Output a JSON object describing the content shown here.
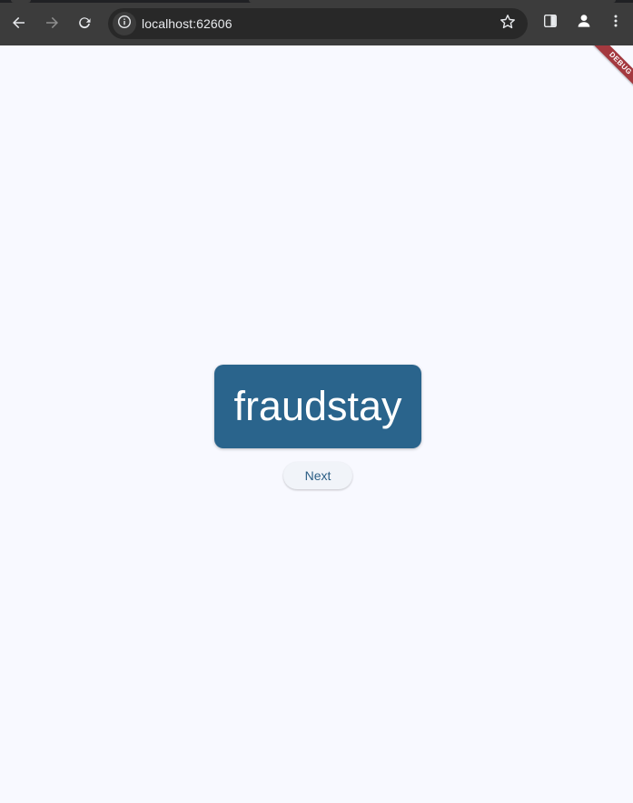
{
  "browser": {
    "url": "localhost:62606",
    "icons": {
      "back": "arrow-left-icon",
      "forward": "arrow-right-icon",
      "reload": "reload-icon",
      "site_info": "info-icon",
      "bookmark": "star-icon",
      "side_panel": "side-panel-icon",
      "profile": "profile-icon",
      "menu": "kebab-menu-icon"
    },
    "colors": {
      "toolbar": "#3c3c3c",
      "omnibox": "#282828",
      "text": "#e8eaed"
    }
  },
  "debug_banner": {
    "label": "DEBUG",
    "color": "#a4393f"
  },
  "app": {
    "word": "fraudstay",
    "next_label": "Next",
    "colors": {
      "background": "#f8f9ff",
      "card": "#2a648c",
      "card_text": "#ffffff",
      "button_text": "#2a5d84"
    }
  }
}
